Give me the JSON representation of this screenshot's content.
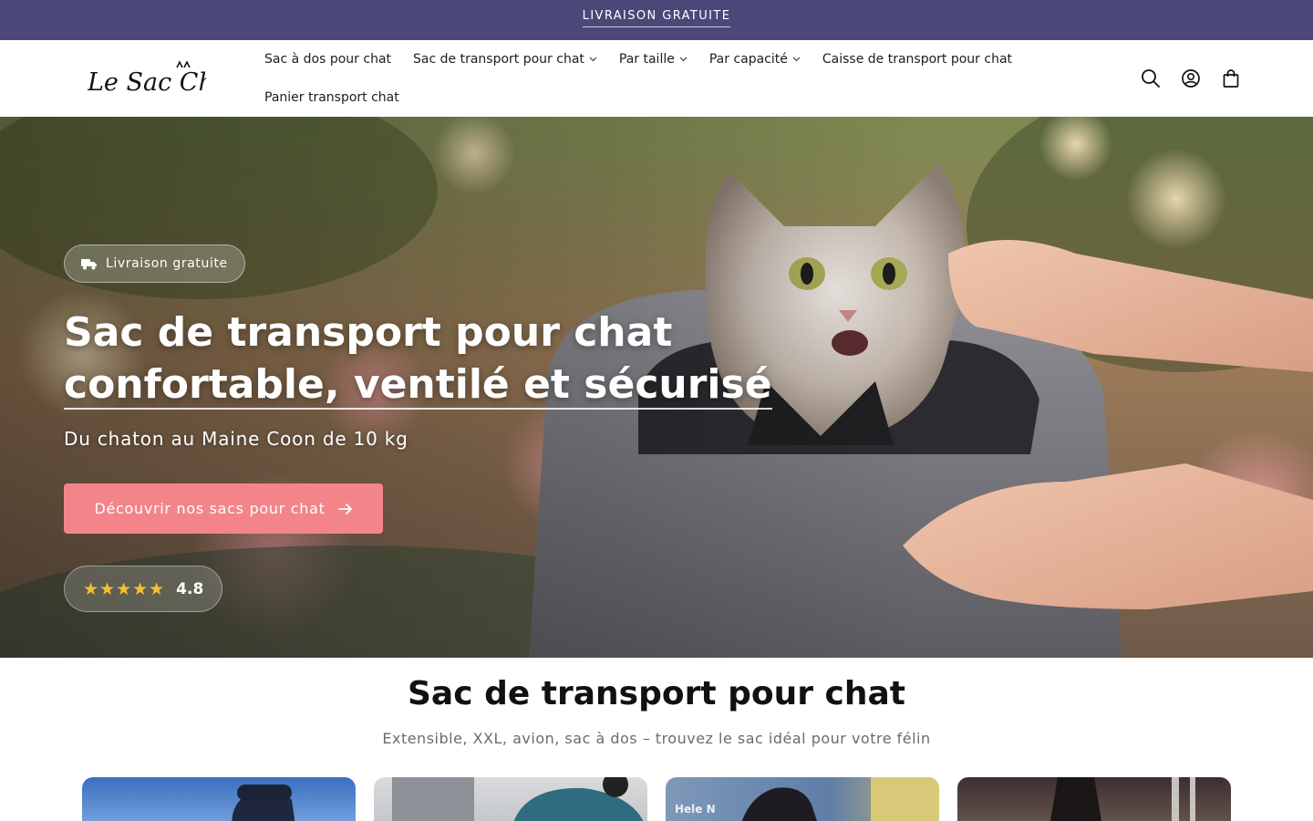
{
  "announcement": {
    "text": "LIVRAISON GRATUITE"
  },
  "header": {
    "logo_text": "Le Sac Chat",
    "nav": [
      {
        "label": "Sac à dos pour chat",
        "has_dropdown": false
      },
      {
        "label": "Sac de transport pour chat",
        "has_dropdown": true
      },
      {
        "label": "Par taille",
        "has_dropdown": true
      },
      {
        "label": "Par capacité",
        "has_dropdown": true
      },
      {
        "label": "Caisse de transport pour chat",
        "has_dropdown": false
      },
      {
        "label": "Panier transport chat",
        "has_dropdown": false
      }
    ],
    "icons": [
      "search-icon",
      "account-icon",
      "cart-icon"
    ]
  },
  "hero": {
    "badge": "Livraison gratuite",
    "title_line1": "Sac de transport pour chat",
    "title_line2": "confortable, ventilé et sécurisé",
    "subtitle": "Du chaton au Maine Coon de 10 kg",
    "cta": "Découvrir nos sacs pour chat",
    "stars": "★★★★★",
    "rating": "4.8"
  },
  "section": {
    "title": "Sac de transport pour chat",
    "subtitle": "Extensible, XXL, avion, sac à dos – trouvez le sac idéal pour votre félin",
    "cards": [
      {
        "caption": ""
      },
      {
        "caption": ""
      },
      {
        "caption": "Hele N"
      },
      {
        "caption": ""
      }
    ]
  },
  "colors": {
    "announcement_bg": "#4b4779",
    "cta_bg": "#f3858a",
    "star": "#f2c12e"
  }
}
